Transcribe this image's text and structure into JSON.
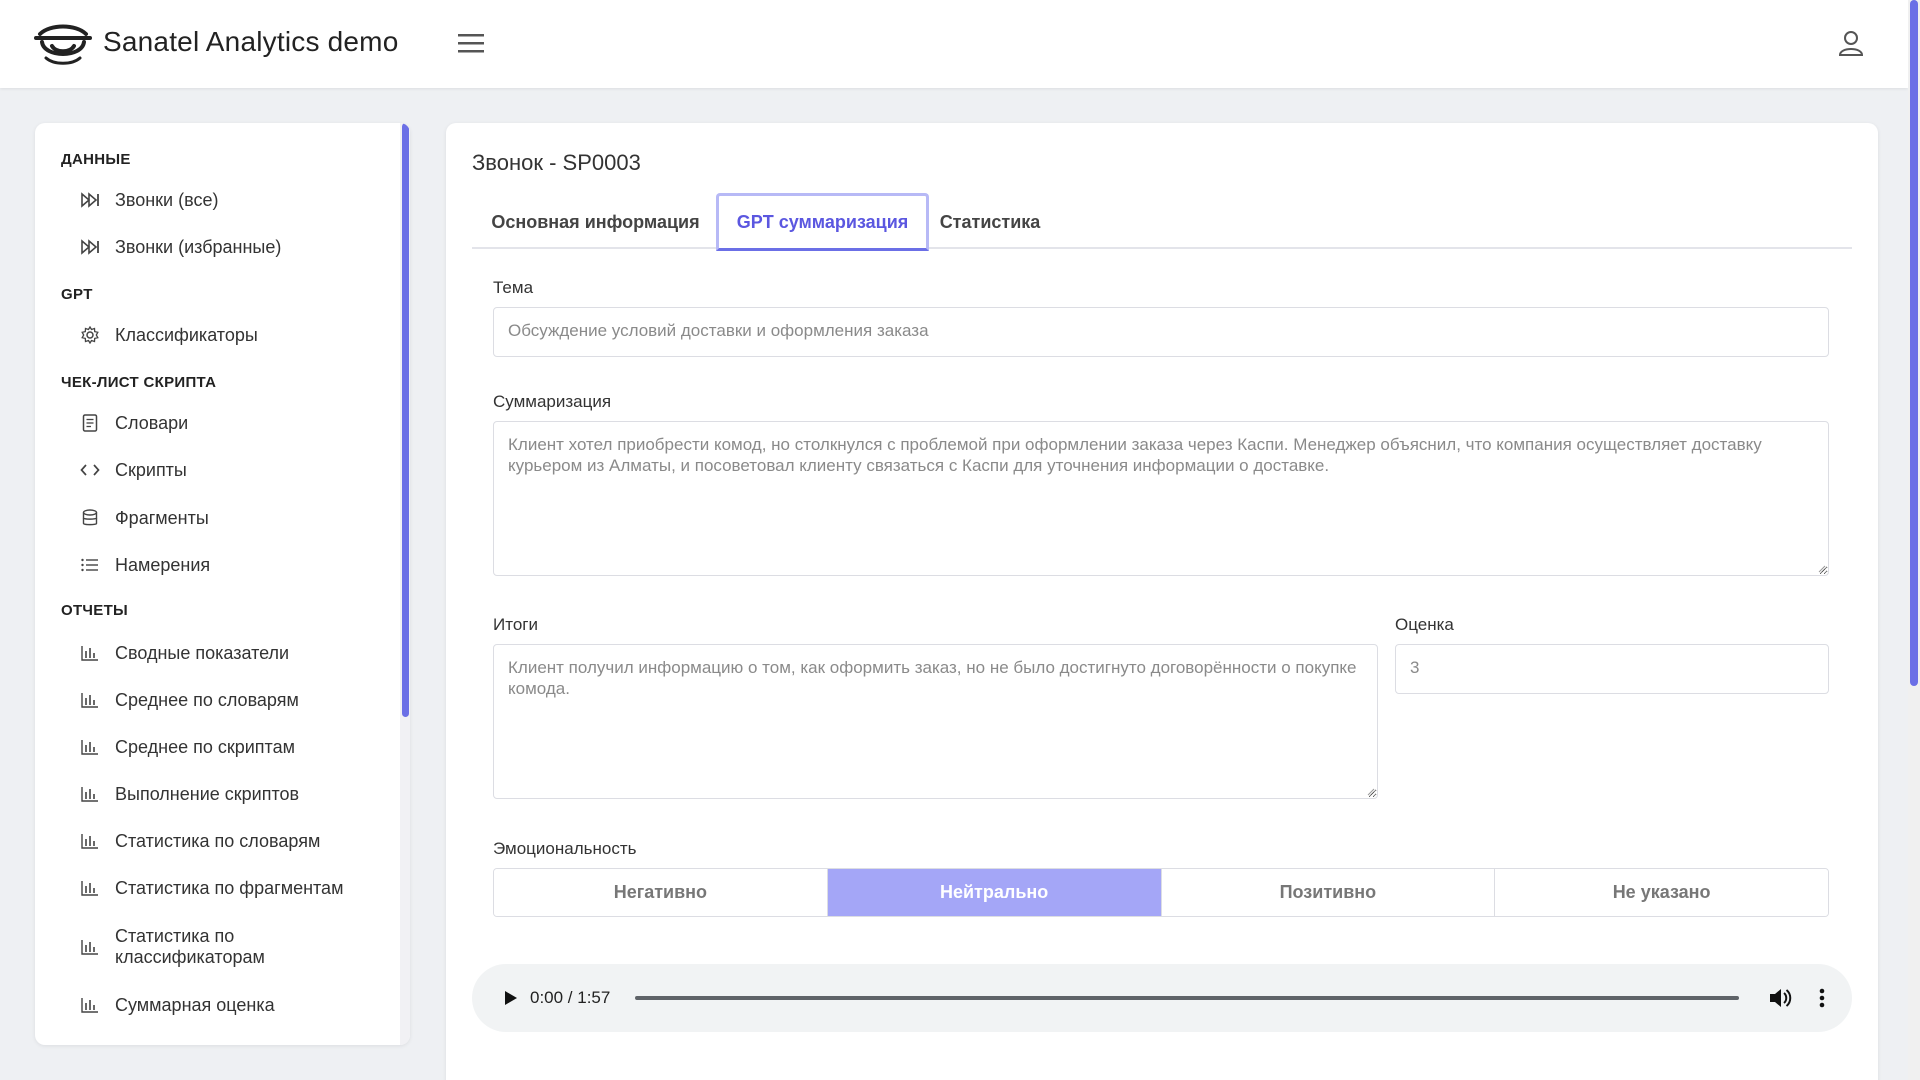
{
  "header": {
    "brand": "Sanatel Analytics demo"
  },
  "sidebar": {
    "sections": [
      {
        "title": "ДАННЫЕ",
        "items": [
          {
            "label": "Звонки (все)",
            "icon": "fast-forward-icon"
          },
          {
            "label": "Звонки (избранные)",
            "icon": "fast-forward-icon"
          }
        ]
      },
      {
        "title": "GPT",
        "items": [
          {
            "label": "Классификаторы",
            "icon": "gear-icon"
          }
        ]
      },
      {
        "title": "ЧЕК-ЛИСТ СКРИПТА",
        "items": [
          {
            "label": "Словари",
            "icon": "book-icon"
          },
          {
            "label": "Скрипты",
            "icon": "code-icon"
          },
          {
            "label": "Фрагменты",
            "icon": "database-icon"
          },
          {
            "label": "Намерения",
            "icon": "list-icon"
          }
        ]
      },
      {
        "title": "ОТЧЕТЫ",
        "items": [
          {
            "label": "Сводные показатели",
            "icon": "bar-chart-icon"
          },
          {
            "label": "Среднее по словарям",
            "icon": "bar-chart-icon"
          },
          {
            "label": "Среднее по скриптам",
            "icon": "bar-chart-icon"
          },
          {
            "label": "Выполнение скриптов",
            "icon": "bar-chart-icon"
          },
          {
            "label": "Статистика по словарям",
            "icon": "bar-chart-icon"
          },
          {
            "label": "Статистика по фрагментам",
            "icon": "bar-chart-icon"
          },
          {
            "label": "Статистика по классификаторам",
            "icon": "bar-chart-icon"
          },
          {
            "label": "Суммарная оценка",
            "icon": "bar-chart-icon"
          }
        ]
      }
    ]
  },
  "main": {
    "title": "Звонок - SP0003",
    "tabs": [
      {
        "label": "Основная информация"
      },
      {
        "label": "GPT суммаризация",
        "active": true
      },
      {
        "label": "Статистика"
      }
    ],
    "topic": {
      "label": "Тема",
      "value": "Обсуждение условий доставки и оформления заказа"
    },
    "summary": {
      "label": "Суммаризация",
      "value": "Клиент хотел приобрести комод, но столкнулся с проблемой при оформлении заказа через Каспи. Менеджер объяснил, что компания осуществляет доставку курьером из Алматы, и посоветовал клиенту связаться с Каспи для уточнения информации о доставке."
    },
    "results": {
      "label": "Итоги",
      "value": "Клиент получил информацию о том, как оформить заказ, но не было достигнуто договорённости о покупке комода."
    },
    "score": {
      "label": "Оценка",
      "value": "3"
    },
    "emotion": {
      "label": "Эмоциональность",
      "options": [
        "Негативно",
        "Нейтрально",
        "Позитивно",
        "Не указано"
      ],
      "selected": "Нейтрально"
    },
    "audio": {
      "time": "0:00 / 1:57"
    }
  },
  "colors": {
    "accent": "#6b6fe6",
    "selected_segment": "#a4a6f7",
    "active_tab_text": "#5b57e0"
  }
}
